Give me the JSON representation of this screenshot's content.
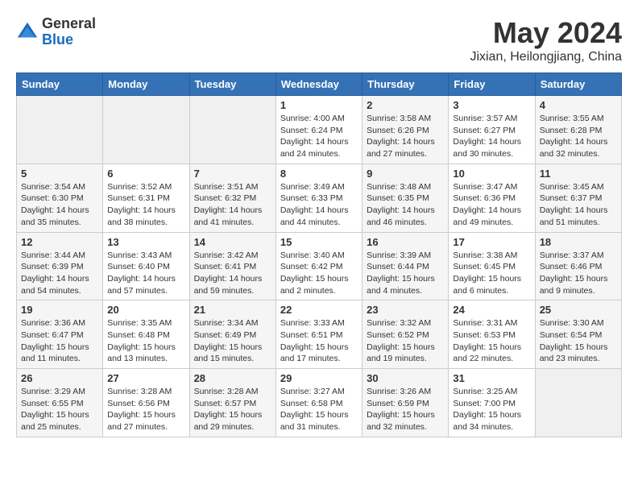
{
  "header": {
    "logo_general": "General",
    "logo_blue": "Blue",
    "month": "May 2024",
    "location": "Jixian, Heilongjiang, China"
  },
  "days_of_week": [
    "Sunday",
    "Monday",
    "Tuesday",
    "Wednesday",
    "Thursday",
    "Friday",
    "Saturday"
  ],
  "weeks": [
    [
      {
        "num": "",
        "info": ""
      },
      {
        "num": "",
        "info": ""
      },
      {
        "num": "",
        "info": ""
      },
      {
        "num": "1",
        "info": "Sunrise: 4:00 AM\nSunset: 6:24 PM\nDaylight: 14 hours\nand 24 minutes."
      },
      {
        "num": "2",
        "info": "Sunrise: 3:58 AM\nSunset: 6:26 PM\nDaylight: 14 hours\nand 27 minutes."
      },
      {
        "num": "3",
        "info": "Sunrise: 3:57 AM\nSunset: 6:27 PM\nDaylight: 14 hours\nand 30 minutes."
      },
      {
        "num": "4",
        "info": "Sunrise: 3:55 AM\nSunset: 6:28 PM\nDaylight: 14 hours\nand 32 minutes."
      }
    ],
    [
      {
        "num": "5",
        "info": "Sunrise: 3:54 AM\nSunset: 6:30 PM\nDaylight: 14 hours\nand 35 minutes."
      },
      {
        "num": "6",
        "info": "Sunrise: 3:52 AM\nSunset: 6:31 PM\nDaylight: 14 hours\nand 38 minutes."
      },
      {
        "num": "7",
        "info": "Sunrise: 3:51 AM\nSunset: 6:32 PM\nDaylight: 14 hours\nand 41 minutes."
      },
      {
        "num": "8",
        "info": "Sunrise: 3:49 AM\nSunset: 6:33 PM\nDaylight: 14 hours\nand 44 minutes."
      },
      {
        "num": "9",
        "info": "Sunrise: 3:48 AM\nSunset: 6:35 PM\nDaylight: 14 hours\nand 46 minutes."
      },
      {
        "num": "10",
        "info": "Sunrise: 3:47 AM\nSunset: 6:36 PM\nDaylight: 14 hours\nand 49 minutes."
      },
      {
        "num": "11",
        "info": "Sunrise: 3:45 AM\nSunset: 6:37 PM\nDaylight: 14 hours\nand 51 minutes."
      }
    ],
    [
      {
        "num": "12",
        "info": "Sunrise: 3:44 AM\nSunset: 6:39 PM\nDaylight: 14 hours\nand 54 minutes."
      },
      {
        "num": "13",
        "info": "Sunrise: 3:43 AM\nSunset: 6:40 PM\nDaylight: 14 hours\nand 57 minutes."
      },
      {
        "num": "14",
        "info": "Sunrise: 3:42 AM\nSunset: 6:41 PM\nDaylight: 14 hours\nand 59 minutes."
      },
      {
        "num": "15",
        "info": "Sunrise: 3:40 AM\nSunset: 6:42 PM\nDaylight: 15 hours\nand 2 minutes."
      },
      {
        "num": "16",
        "info": "Sunrise: 3:39 AM\nSunset: 6:44 PM\nDaylight: 15 hours\nand 4 minutes."
      },
      {
        "num": "17",
        "info": "Sunrise: 3:38 AM\nSunset: 6:45 PM\nDaylight: 15 hours\nand 6 minutes."
      },
      {
        "num": "18",
        "info": "Sunrise: 3:37 AM\nSunset: 6:46 PM\nDaylight: 15 hours\nand 9 minutes."
      }
    ],
    [
      {
        "num": "19",
        "info": "Sunrise: 3:36 AM\nSunset: 6:47 PM\nDaylight: 15 hours\nand 11 minutes."
      },
      {
        "num": "20",
        "info": "Sunrise: 3:35 AM\nSunset: 6:48 PM\nDaylight: 15 hours\nand 13 minutes."
      },
      {
        "num": "21",
        "info": "Sunrise: 3:34 AM\nSunset: 6:49 PM\nDaylight: 15 hours\nand 15 minutes."
      },
      {
        "num": "22",
        "info": "Sunrise: 3:33 AM\nSunset: 6:51 PM\nDaylight: 15 hours\nand 17 minutes."
      },
      {
        "num": "23",
        "info": "Sunrise: 3:32 AM\nSunset: 6:52 PM\nDaylight: 15 hours\nand 19 minutes."
      },
      {
        "num": "24",
        "info": "Sunrise: 3:31 AM\nSunset: 6:53 PM\nDaylight: 15 hours\nand 22 minutes."
      },
      {
        "num": "25",
        "info": "Sunrise: 3:30 AM\nSunset: 6:54 PM\nDaylight: 15 hours\nand 23 minutes."
      }
    ],
    [
      {
        "num": "26",
        "info": "Sunrise: 3:29 AM\nSunset: 6:55 PM\nDaylight: 15 hours\nand 25 minutes."
      },
      {
        "num": "27",
        "info": "Sunrise: 3:28 AM\nSunset: 6:56 PM\nDaylight: 15 hours\nand 27 minutes."
      },
      {
        "num": "28",
        "info": "Sunrise: 3:28 AM\nSunset: 6:57 PM\nDaylight: 15 hours\nand 29 minutes."
      },
      {
        "num": "29",
        "info": "Sunrise: 3:27 AM\nSunset: 6:58 PM\nDaylight: 15 hours\nand 31 minutes."
      },
      {
        "num": "30",
        "info": "Sunrise: 3:26 AM\nSunset: 6:59 PM\nDaylight: 15 hours\nand 32 minutes."
      },
      {
        "num": "31",
        "info": "Sunrise: 3:25 AM\nSunset: 7:00 PM\nDaylight: 15 hours\nand 34 minutes."
      },
      {
        "num": "",
        "info": ""
      }
    ]
  ]
}
